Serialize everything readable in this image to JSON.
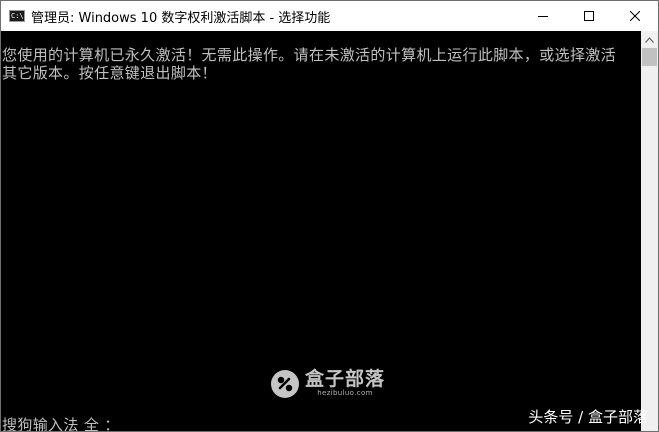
{
  "window": {
    "title": "管理员: Windows 10 数字权利激活脚本 - 选择功能",
    "app_icon_glyph": "C:\\"
  },
  "caption_buttons": {
    "minimize_icon": "minimize-icon",
    "maximize_icon": "maximize-icon",
    "close_icon": "close-icon"
  },
  "console": {
    "lines": [
      "您使用的计算机已永久激活！无需此操作。请在未激活的计算机上运行此脚本，或选择激活",
      "其它版本。按任意键退出脚本！"
    ],
    "ime_status": "搜狗输入法 全 ："
  },
  "watermark": {
    "title": "盒子部落",
    "url": "hezibuluo.com"
  },
  "source_credit": "头条号 / 盒子部落",
  "colors": {
    "console_bg": "#000000",
    "console_text": "#c0c0c0",
    "titlebar_bg": "#ffffff",
    "scrollbar_bg": "#f0f0f0",
    "scroll_thumb": "#c1c1c1"
  }
}
